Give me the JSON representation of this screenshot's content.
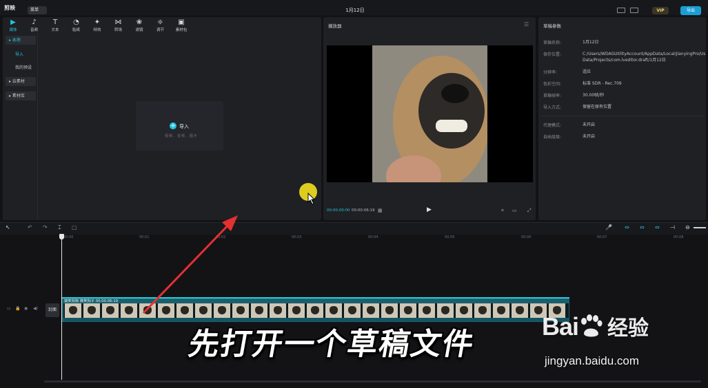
{
  "app": {
    "logo": "剪映",
    "menu_label": "菜单",
    "project_title": "1月12日",
    "vip_label": "VIP",
    "export_label": "导出"
  },
  "media_toolbar": [
    {
      "label": "媒体",
      "icon": "media-icon"
    },
    {
      "label": "音频",
      "icon": "audio-icon"
    },
    {
      "label": "文本",
      "icon": "text-icon"
    },
    {
      "label": "贴纸",
      "icon": "sticker-icon"
    },
    {
      "label": "特效",
      "icon": "effects-icon"
    },
    {
      "label": "转场",
      "icon": "transition-icon"
    },
    {
      "label": "滤镜",
      "icon": "filter-icon"
    },
    {
      "label": "调节",
      "icon": "adjust-icon"
    },
    {
      "label": "素材包",
      "icon": "package-icon"
    }
  ],
  "sidebar": [
    {
      "label": "▸ 本地"
    },
    {
      "label": "导入"
    },
    {
      "label": "我的预设"
    },
    {
      "label": "▸ 云素材"
    },
    {
      "label": "▸ 素材库"
    }
  ],
  "import": {
    "label": "导入",
    "sub": "视频、音频、图片"
  },
  "player": {
    "title": "播放器",
    "current_time": "00:00:00:00",
    "total_time": "00:00:06:19"
  },
  "properties": {
    "title": "草稿参数",
    "rows": [
      {
        "label": "草稿名称:",
        "value": "1月12日"
      },
      {
        "label": "保存位置:",
        "value": "C:/Users/WDAGUtilityAccount/AppData/Local/JianyingPro/User Data/Projects/com.lveditor.draft/1月12日"
      },
      {
        "label": "分辨率:",
        "value": "适应"
      },
      {
        "label": "色彩空间:",
        "value": "标准 SDR - Rec.709"
      },
      {
        "label": "草稿帧率:",
        "value": "30.00帧/秒"
      },
      {
        "label": "导入方式:",
        "value": "保留在原有位置"
      },
      {
        "label": "代理模式:",
        "value": "未开启"
      },
      {
        "label": "自由层级:",
        "value": "未开启"
      }
    ]
  },
  "timeline": {
    "ticks": [
      "00:00",
      "00:01",
      "00:02",
      "00:03",
      "00:04",
      "00:05",
      "00:06",
      "00:07",
      "00:08"
    ],
    "cover_label": "封面",
    "clip_label": "搞笑狗狗 微笑狗子  00:00:06:19"
  },
  "overlay": {
    "subtitle": "先打开一个草稿文件",
    "watermark_brand": "Bai",
    "watermark_suffix": "经验",
    "watermark_url": "jingyan.baidu.com"
  },
  "colors": {
    "accent": "#25c2e0",
    "arrow": "#e53030",
    "clip": "#1b5f6b"
  }
}
